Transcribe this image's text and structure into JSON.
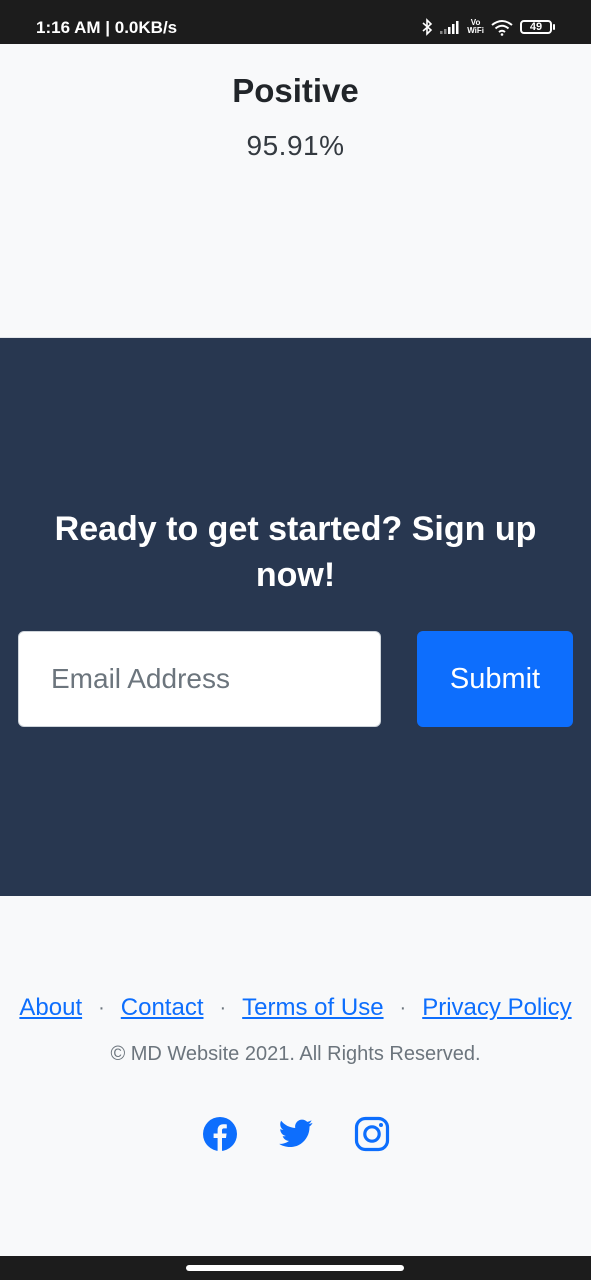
{
  "status_bar": {
    "time_speed": "1:16 AM | 0.0KB/s",
    "vowifi_top": "Vo",
    "vowifi_bottom": "WiFi",
    "battery": "49"
  },
  "result": {
    "label": "Positive",
    "value": "95.91%"
  },
  "cta": {
    "heading": "Ready to get started? Sign up now!",
    "email_placeholder": "Email Address",
    "email_value": "",
    "submit_label": "Submit"
  },
  "footer": {
    "links": [
      "About",
      "Contact",
      "Terms of Use",
      "Privacy Policy"
    ],
    "separator": "·",
    "copyright": "© MD Website 2021. All Rights Reserved."
  },
  "social": {
    "icons": [
      "facebook-icon",
      "twitter-icon",
      "instagram-icon"
    ],
    "color": "#0d6efd"
  },
  "colors": {
    "cta_background": "#283750",
    "accent": "#0d6efd"
  }
}
